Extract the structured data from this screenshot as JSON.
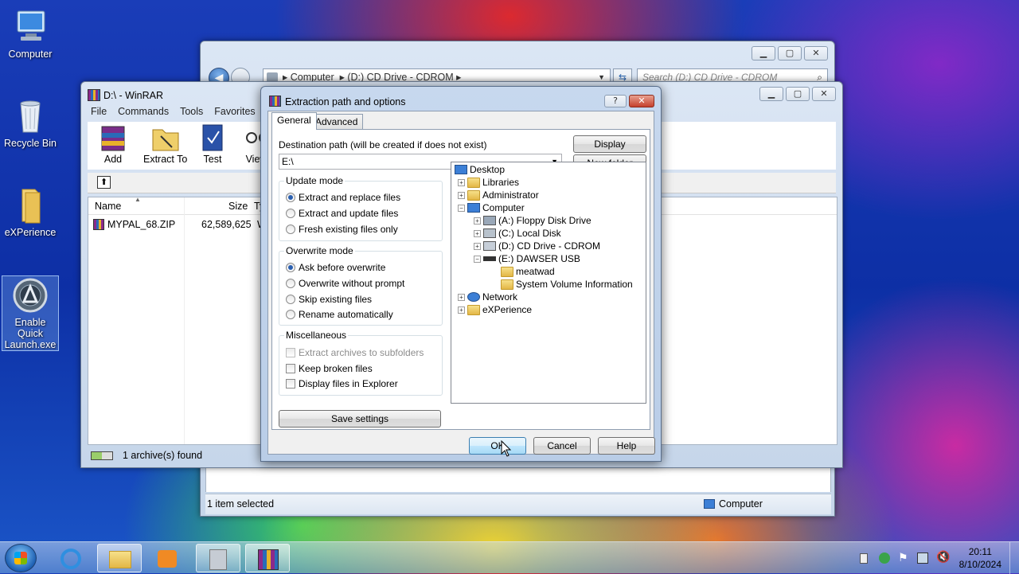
{
  "desktop": {
    "icons": [
      {
        "label": "Computer"
      },
      {
        "label": "Recycle Bin"
      },
      {
        "label": "eXPerience"
      },
      {
        "label": "Enable Quick Launch.exe"
      }
    ]
  },
  "explorer": {
    "breadcrumb": [
      "Computer",
      "(D:) CD Drive - CDROM"
    ],
    "search_placeholder": "Search (D:) CD Drive - CDROM",
    "status_left": "1 item selected",
    "status_right": "Computer"
  },
  "winrar": {
    "title": "D:\\ - WinRAR",
    "menu": [
      "File",
      "Commands",
      "Tools",
      "Favorites"
    ],
    "toolbar": [
      "Add",
      "Extract To",
      "Test",
      "View"
    ],
    "columns": [
      "Name",
      "Size",
      "Ty"
    ],
    "rows": [
      {
        "name": "MYPAL_68.ZIP",
        "size": "62,589,625",
        "type": "W"
      }
    ],
    "status": "1 archive(s) found"
  },
  "dialog": {
    "title": "Extraction path and options",
    "title_help": "?",
    "tabs": [
      "General",
      "Advanced"
    ],
    "dest_label": "Destination path (will be created if does not exist)",
    "dest_value": "E:\\",
    "display_button": "Display",
    "new_folder_button": "New folder",
    "update_mode": {
      "title": "Update mode",
      "options": [
        "Extract and replace files",
        "Extract and update files",
        "Fresh existing files only"
      ],
      "selected": 0
    },
    "overwrite_mode": {
      "title": "Overwrite mode",
      "options": [
        "Ask before overwrite",
        "Overwrite without prompt",
        "Skip existing files",
        "Rename automatically"
      ],
      "selected": 0
    },
    "misc": {
      "title": "Miscellaneous",
      "options": [
        "Extract archives to subfolders",
        "Keep broken files",
        "Display files in Explorer"
      ]
    },
    "save_settings": "Save settings",
    "tree": [
      "Desktop",
      "Libraries",
      "Administrator",
      "Computer",
      "(A:) Floppy Disk Drive",
      "(C:) Local Disk",
      "(D:) CD Drive - CDROM",
      "(E:) DAWSER USB",
      "meatwad",
      "System Volume Information",
      "Network",
      "eXPerience"
    ],
    "ok": "OK",
    "cancel": "Cancel",
    "help": "Help"
  },
  "taskbar": {
    "time": "20:11",
    "date": "8/10/2024"
  }
}
